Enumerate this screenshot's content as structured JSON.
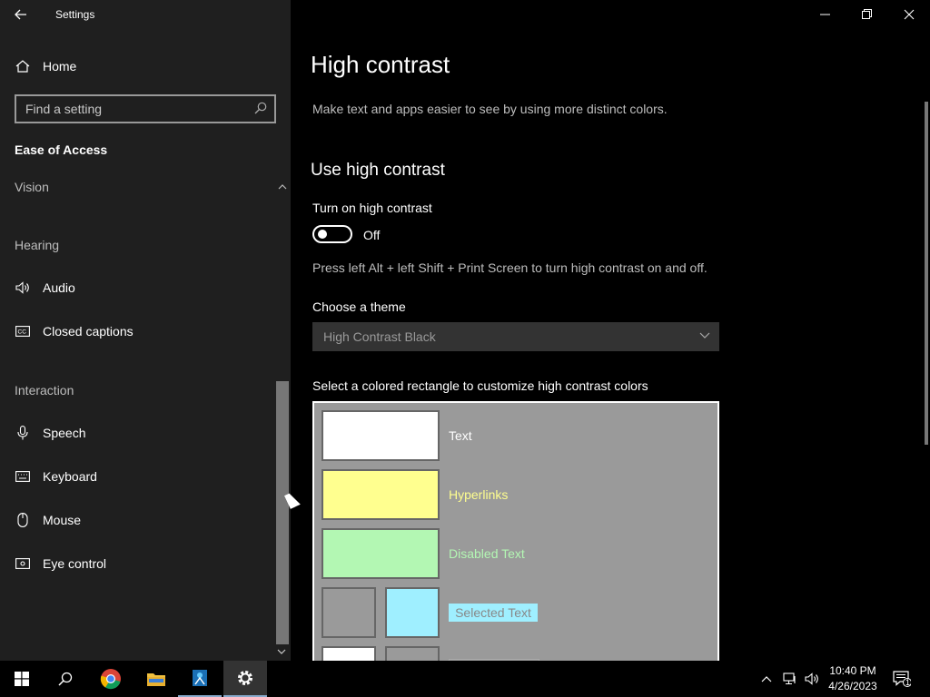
{
  "app": {
    "title": "Settings"
  },
  "sidebar": {
    "home_label": "Home",
    "search_placeholder": "Find a setting",
    "section_title": "Ease of Access",
    "groups": {
      "vision": "Vision",
      "hearing": "Hearing",
      "interaction": "Interaction"
    },
    "items": [
      {
        "label": "Audio",
        "icon": "speaker-icon"
      },
      {
        "label": "Closed captions",
        "icon": "cc-icon"
      },
      {
        "label": "Speech",
        "icon": "microphone-icon"
      },
      {
        "label": "Keyboard",
        "icon": "keyboard-icon"
      },
      {
        "label": "Mouse",
        "icon": "mouse-icon"
      },
      {
        "label": "Eye control",
        "icon": "eye-control-icon"
      }
    ]
  },
  "main": {
    "title": "High contrast",
    "description": "Make text and apps easier to see by using more distinct colors.",
    "section_heading": "Use high contrast",
    "toggle_label": "Turn on high contrast",
    "toggle_state": "Off",
    "hint": "Press left Alt + left Shift + Print Screen to turn high contrast on and off.",
    "theme_label": "Choose a theme",
    "theme_value": "High Contrast Black",
    "colors_label": "Select a colored rectangle to customize high contrast colors",
    "color_rows": [
      {
        "label": "Text",
        "color": "#ffffff"
      },
      {
        "label": "Hyperlinks",
        "color": "#ffff8f"
      },
      {
        "label": "Disabled Text",
        "color": "#b3f7b3"
      },
      {
        "label": "Selected Text",
        "color": "#9fefff"
      }
    ]
  },
  "taskbar": {
    "time": "10:40 PM",
    "date": "4/26/2023",
    "notification_count": "1"
  },
  "colors": {
    "sidebar_bg": "#1f1f1f",
    "main_bg": "#000000",
    "panel_bg": "#9a9a9a"
  }
}
